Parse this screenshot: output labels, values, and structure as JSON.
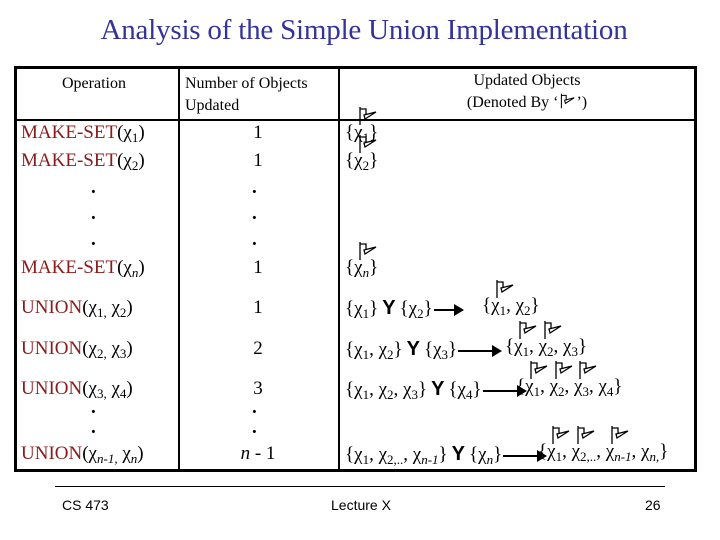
{
  "slide": {
    "title": "Analysis of the Simple Union Implementation",
    "footer": {
      "left": "CS 473",
      "center": "Lecture X",
      "right": "26"
    },
    "colors": {
      "title": "#333399",
      "operation": "#8b1a1a",
      "text": "#000000"
    }
  },
  "table": {
    "headers": {
      "operation": "Operation",
      "count_line1": "Number of Objects",
      "count_line2": "Updated",
      "updated_line1": "Updated Objects",
      "updated_line2_pre": "(Denoted By ‘",
      "updated_line2_post": "’)",
      "marker_icon": "flag-icon"
    },
    "chi": "χ",
    "union_symbol": "Y",
    "make_set_rows": [
      {
        "op": "MAKE-SET",
        "arg_sub": "1",
        "count": "1",
        "set_sub": "1"
      },
      {
        "op": "MAKE-SET",
        "arg_sub": "2",
        "count": "1",
        "set_sub": "2"
      },
      {
        "op": "MAKE-SET",
        "arg_sub": "n",
        "count": "1",
        "set_sub": "n"
      }
    ],
    "ellipsis": ".",
    "union_rows": [
      {
        "op": "UNION",
        "args": [
          "1",
          "2"
        ],
        "count": "1",
        "left": [
          "1"
        ],
        "right": [
          "2"
        ],
        "result": [
          "1",
          "2"
        ],
        "flagged": 1
      },
      {
        "op": "UNION",
        "args": [
          "2",
          "3"
        ],
        "count": "2",
        "left": [
          "1",
          "2"
        ],
        "right": [
          "3"
        ],
        "result": [
          "1",
          "2",
          "3"
        ],
        "flagged": 2
      },
      {
        "op": "UNION",
        "args": [
          "3",
          "4"
        ],
        "count": "3",
        "left": [
          "1",
          "2",
          "3"
        ],
        "right": [
          "4"
        ],
        "result": [
          "1",
          "2",
          "3",
          "4"
        ],
        "flagged": 3
      },
      {
        "op": "UNION",
        "args": [
          "n-1",
          "n"
        ],
        "count": "n - 1",
        "left": [
          "1",
          "2,..",
          "n-1"
        ],
        "right": [
          "n"
        ],
        "result": [
          "1",
          "2,..",
          "n-1",
          "n,"
        ],
        "flagged": 3
      }
    ]
  }
}
